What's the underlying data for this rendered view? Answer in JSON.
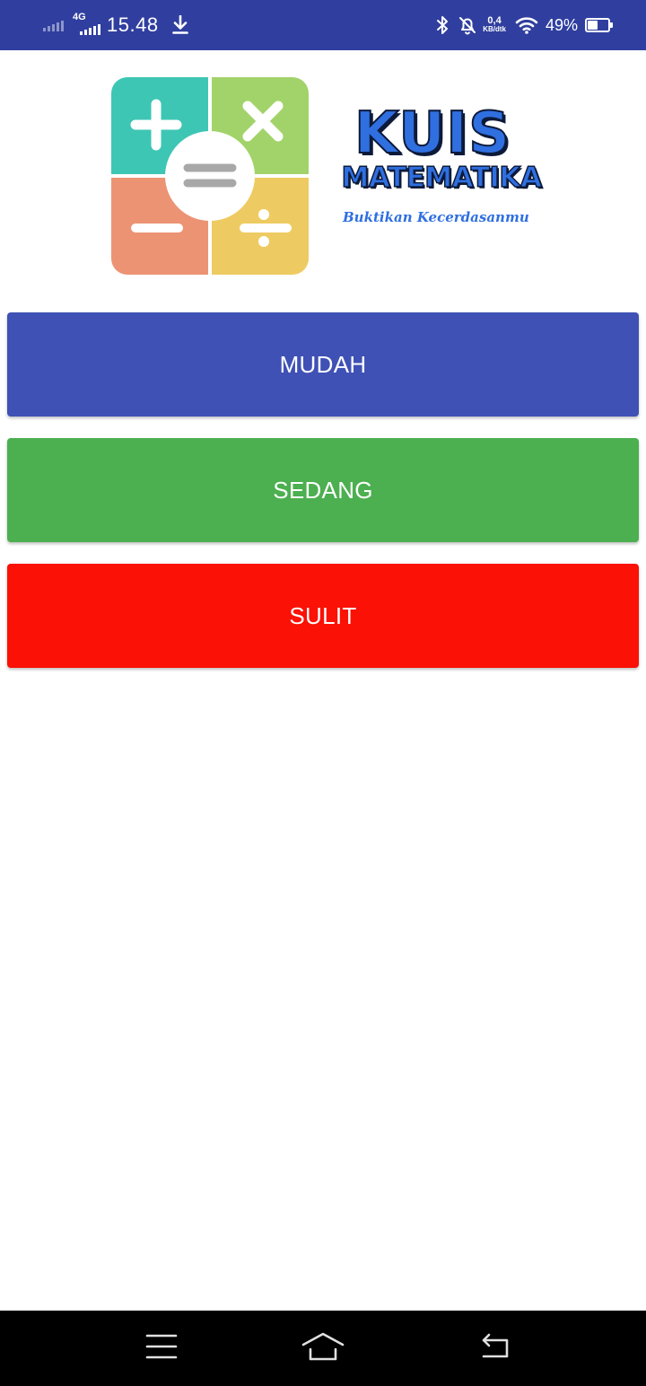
{
  "status_bar": {
    "network_type": "4G",
    "time": "15.48",
    "speed_value": "0,4",
    "speed_unit": "KB/dtk",
    "battery_percent": "49%",
    "battery_level": 0.49,
    "background_color": "#303F9F"
  },
  "logo": {
    "title_line1": "KUIS",
    "title_line2": "MATEMATIKA",
    "tagline": "Buktikan Kecerdasanmu",
    "icon": "math-operators-icon",
    "tile_colors": {
      "plus": "#3EC6B4",
      "times": "#A2D36A",
      "minus": "#EC9374",
      "divide": "#EECB62"
    },
    "title_color": "#2F6FE0"
  },
  "levels": [
    {
      "label": "MUDAH",
      "color": "#3F51B5"
    },
    {
      "label": "SEDANG",
      "color": "#4CAF50"
    },
    {
      "label": "SULIT",
      "color": "#FB1106"
    }
  ],
  "nav_bar": {
    "icons": [
      "menu-icon",
      "home-icon",
      "back-icon"
    ]
  }
}
